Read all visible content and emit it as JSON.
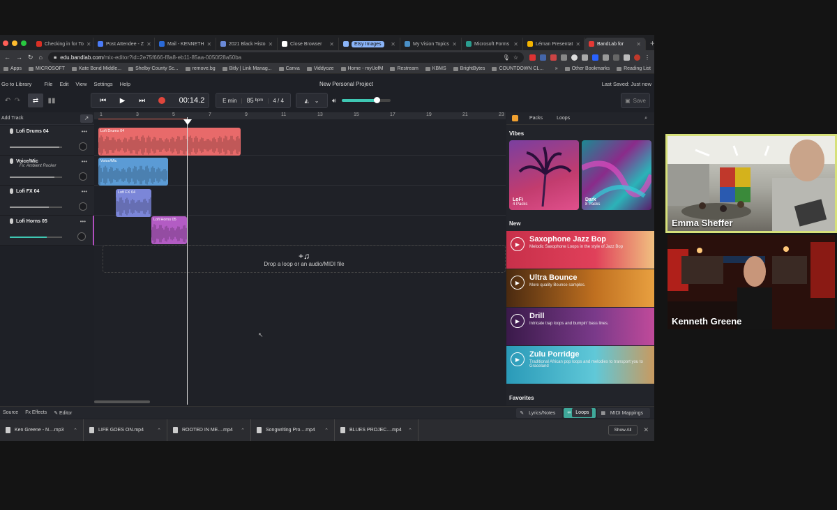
{
  "browser": {
    "tabs": [
      {
        "label": "Checking in for To",
        "color": "#d93025"
      },
      {
        "label": "Post Attendee - Z",
        "color": "#4a7bf7"
      },
      {
        "label": "Mail - KENNETH",
        "color": "#2a6ad8"
      },
      {
        "label": "2021 Black Histo",
        "color": "#6b8ad8"
      },
      {
        "label": "Close Browser",
        "color": "#ffffff"
      },
      {
        "label": "Etsy Images",
        "color": "#8ab4f8"
      },
      {
        "label": "My Vision Topics",
        "color": "#4a90c8"
      },
      {
        "label": "Microsoft Forms",
        "color": "#2a9d8f"
      },
      {
        "label": "Léman Presentat",
        "color": "#f4b400"
      },
      {
        "label": "BandLab for",
        "color": "#e53935"
      }
    ],
    "new_tab": "+",
    "url_host": "edu.bandlab.com",
    "url_path": "/mix-editor?id=2e75f666-f8a8-eb11-85aa-0050f28a50ba",
    "bookmarks": [
      "Apps",
      "MICROSOFT",
      "Kate Bond Middle...",
      "Shelby County Sc...",
      "remove.bg",
      "Bitly | Link Manag...",
      "Canva",
      "Viddyoze",
      "Home - myUofM",
      "Restream",
      "KBMS",
      "BrightBytes",
      "COUNTDOWN CL..."
    ],
    "bookmarks_more": "»",
    "other_bookmarks": "Other Bookmarks",
    "reading_list": "Reading List"
  },
  "app": {
    "back": "Go to Library",
    "menu": [
      "File",
      "Edit",
      "View",
      "Settings",
      "Help"
    ],
    "title": "New Personal Project",
    "saved": "Last Saved: Just now",
    "time": "00:14.2",
    "key": "E min",
    "bpm": "85",
    "bpm_unit": "bpm",
    "meter": "4 / 4",
    "volume_level": 0.72,
    "save": "Save",
    "add_track": "Add Track"
  },
  "tracks": [
    {
      "name": "Lofi Drums 04",
      "sub": "",
      "level": 0.95
    },
    {
      "name": "Voice/Mic",
      "sub": "Fx: Ambient Rocker",
      "level": 0.85
    },
    {
      "name": "Lofi FX 04",
      "sub": "",
      "level": 0.75
    },
    {
      "name": "Lofi Horns 05",
      "sub": "",
      "level": 0.7
    }
  ],
  "ruler": [
    "1",
    "3",
    "5",
    "7",
    "9",
    "11",
    "13",
    "15",
    "17",
    "19",
    "21",
    "23"
  ],
  "clips": [
    {
      "label": "Lofi Drums 04",
      "color": "#e86a6a"
    },
    {
      "label": "Voice/Mic",
      "color": "#5b9bd5"
    },
    {
      "label": "Lofi FX 04",
      "color": "#7b86d8"
    },
    {
      "label": "Lofi Horns 05",
      "color": "#b35cc4"
    }
  ],
  "drop_text": "Drop a loop or an audio/MIDI file",
  "panel": {
    "tabs": [
      "Packs",
      "Loops"
    ],
    "vibes_title": "Vibes",
    "vibes": [
      {
        "name": "LoFi",
        "count": "4 Packs"
      },
      {
        "name": "Dark",
        "count": "8 Packs"
      }
    ],
    "new_title": "New",
    "packs": [
      {
        "title": "Saxophone Jazz Bop",
        "desc": "Melodic Saxophone Loops in the style of Jazz Bop"
      },
      {
        "title": "Ultra Bounce",
        "desc": "More quality Bounce samples."
      },
      {
        "title": "Drill",
        "desc": "Intricate trap loops and bumpin' bass lines."
      },
      {
        "title": "Zulu Porridge",
        "desc": "Traditional African pop loops and melodies to transport you to Graceland"
      }
    ],
    "favorites_title": "Favorites"
  },
  "bottom": {
    "left": [
      "Source",
      "Fx Effects",
      "Editor"
    ],
    "right": [
      "Lyrics/Notes",
      "Loops",
      "MIDI Mappings"
    ]
  },
  "downloads": [
    "Ken Greene - N....mp3",
    "LIFE GOES ON.mp4",
    "ROOTED IN ME....mp4",
    "Songwriting Pro....mp4",
    "BLUES PROJEC....mp4"
  ],
  "show_all": "Show All",
  "participants": [
    {
      "name": "Emma Sheffer"
    },
    {
      "name": "Kenneth Greene"
    }
  ]
}
